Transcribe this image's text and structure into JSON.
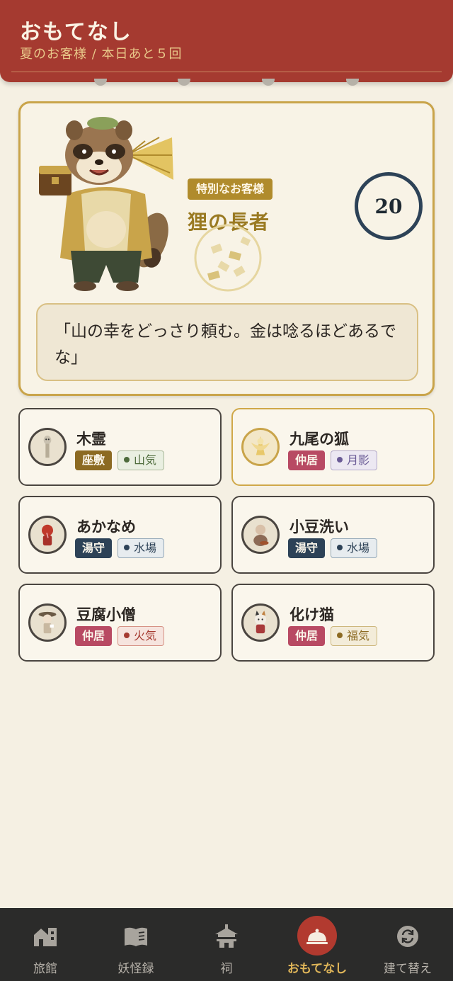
{
  "header": {
    "title": "おもてなし",
    "subtitle": "夏のお客様 / 本日あと５回"
  },
  "featured": {
    "badge": "特別なお客様",
    "name": "狸の長者",
    "count": "20",
    "speech": "「山の幸をどっさり頼む。金は唸るほどあるでな」"
  },
  "guests": [
    {
      "name": "木霊",
      "role": "座敷",
      "attr": "山気"
    },
    {
      "name": "九尾の狐",
      "role": "仲居",
      "attr": "月影"
    },
    {
      "name": "あかなめ",
      "role": "湯守",
      "attr": "水場"
    },
    {
      "name": "小豆洗い",
      "role": "湯守",
      "attr": "水場"
    },
    {
      "name": "豆腐小僧",
      "role": "仲居",
      "attr": "火気"
    },
    {
      "name": "化け猫",
      "role": "仲居",
      "attr": "福気"
    }
  ],
  "nav": [
    {
      "label": "旅館",
      "icon": "inn-icon"
    },
    {
      "label": "妖怪録",
      "icon": "book-icon"
    },
    {
      "label": "祠",
      "icon": "shrine-icon"
    },
    {
      "label": "おもてなし",
      "icon": "cloche-icon",
      "active": true
    },
    {
      "label": "建て替え",
      "icon": "rebuild-icon"
    }
  ],
  "colors": {
    "header": "#a53a30",
    "gold": "#c9a44a",
    "navy": "#2d4257",
    "nav_bg": "#2b2b2a",
    "active_label": "#e0b659"
  }
}
